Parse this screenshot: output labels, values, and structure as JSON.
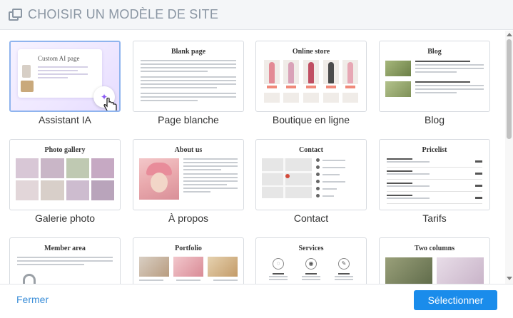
{
  "header": {
    "title": "CHOISIR UN MODÈLE DE SITE",
    "icon": "copy-pages-icon"
  },
  "templates": [
    {
      "caption": "Assistant IA",
      "preview_title": "Custom AI page",
      "selected": true,
      "icon": "sparkle-icon"
    },
    {
      "caption": "Page blanche",
      "preview_title": "Blank page"
    },
    {
      "caption": "Boutique en ligne",
      "preview_title": "Online store"
    },
    {
      "caption": "Blog",
      "preview_title": "Blog"
    },
    {
      "caption": "Galerie photo",
      "preview_title": "Photo gallery"
    },
    {
      "caption": "À propos",
      "preview_title": "About us"
    },
    {
      "caption": "Contact",
      "preview_title": "Contact"
    },
    {
      "caption": "Tarifs",
      "preview_title": "Pricelist"
    },
    {
      "caption": "",
      "preview_title": "Member area"
    },
    {
      "caption": "",
      "preview_title": "Portfolio"
    },
    {
      "caption": "",
      "preview_title": "Services"
    },
    {
      "caption": "",
      "preview_title": "Two columns"
    }
  ],
  "footer": {
    "close_label": "Fermer",
    "select_label": "Sélectionner"
  },
  "colors": {
    "accent": "#1a8ceb",
    "link": "#3b8ed8",
    "header_text": "#8a96a3"
  }
}
